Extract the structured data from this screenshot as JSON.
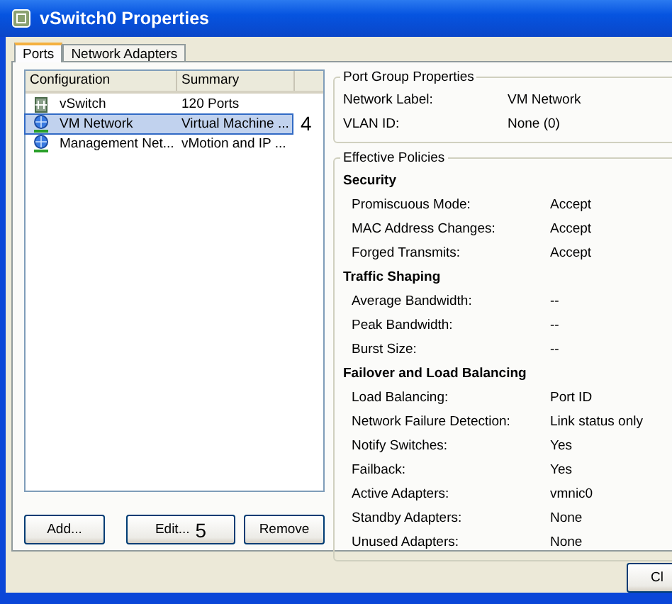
{
  "window": {
    "title": "vSwitch0 Properties"
  },
  "tabs": [
    {
      "label": "Ports",
      "selected": true
    },
    {
      "label": "Network Adapters",
      "selected": false
    }
  ],
  "list": {
    "columns": [
      "Configuration",
      "Summary"
    ],
    "rows": [
      {
        "kind": "switch",
        "name": "vSwitch",
        "summary": "120 Ports",
        "selected": false
      },
      {
        "kind": "portgroup",
        "name": "VM Network",
        "summary": "Virtual Machine ...",
        "selected": true,
        "callout": "4"
      },
      {
        "kind": "portgroup",
        "name": "Management Net...",
        "summary": "vMotion and IP ...",
        "selected": false
      }
    ]
  },
  "list_buttons": [
    {
      "label": "Add..."
    },
    {
      "label": "Edit...",
      "callout": "5"
    },
    {
      "label": "Remove"
    }
  ],
  "port_group_properties": {
    "title": "Port Group Properties",
    "rows": [
      {
        "label": "Network Label:",
        "value": "VM Network"
      },
      {
        "label": "VLAN ID:",
        "value": "None (0)"
      }
    ]
  },
  "effective_policies": {
    "title": "Effective Policies",
    "sections": [
      {
        "heading": "Security",
        "rows": [
          {
            "label": "Promiscuous Mode:",
            "value": "Accept"
          },
          {
            "label": "MAC Address Changes:",
            "value": "Accept"
          },
          {
            "label": "Forged Transmits:",
            "value": "Accept"
          }
        ]
      },
      {
        "heading": "Traffic Shaping",
        "rows": [
          {
            "label": "Average Bandwidth:",
            "value": "--"
          },
          {
            "label": "Peak Bandwidth:",
            "value": "--"
          },
          {
            "label": "Burst Size:",
            "value": "--"
          }
        ]
      },
      {
        "heading": "Failover and Load Balancing",
        "rows": [
          {
            "label": "Load Balancing:",
            "value": "Port ID"
          },
          {
            "label": "Network Failure Detection:",
            "value": "Link status only"
          },
          {
            "label": "Notify Switches:",
            "value": "Yes"
          },
          {
            "label": "Failback:",
            "value": "Yes"
          },
          {
            "label": "Active Adapters:",
            "value": "vmnic0"
          },
          {
            "label": "Standby Adapters:",
            "value": "None"
          },
          {
            "label": "Unused Adapters:",
            "value": "None"
          }
        ]
      }
    ]
  },
  "dialog_buttons": [
    {
      "label": "Cl"
    }
  ]
}
